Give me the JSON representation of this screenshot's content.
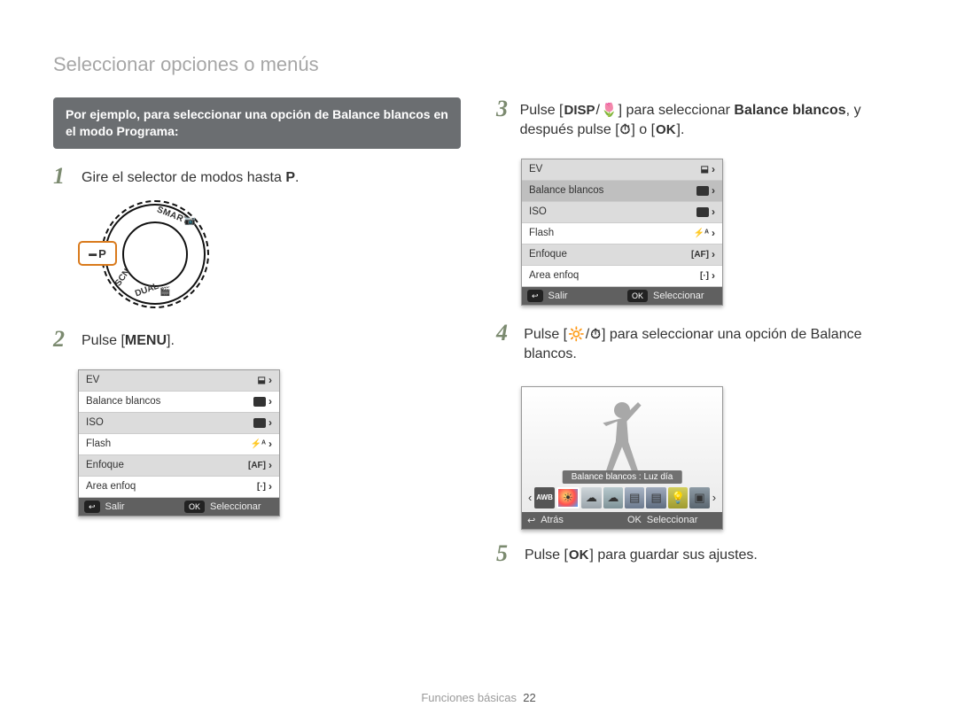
{
  "page_title": "Seleccionar opciones o menús",
  "example_box": "Por ejemplo, para seleccionar una opción de Balance blancos en el modo Programa:",
  "steps": {
    "s1": {
      "num": "1",
      "pre": "Gire el selector de modos hasta ",
      "mode": "P",
      "post": "."
    },
    "s2": {
      "num": "2",
      "pre": "Pulse [",
      "key": "MENU",
      "post": "]."
    },
    "s3": {
      "num": "3",
      "pre": "Pulse [",
      "key1": "DISP",
      "sep": "/",
      "key2": "🌷",
      "mid": "] para seleccionar ",
      "target": "Balance blancos",
      "post1": ", y después pulse [",
      "key3": "⏱",
      "post2": "] o [",
      "key4": "OK",
      "post3": "]."
    },
    "s4": {
      "num": "4",
      "pre": "Pulse [",
      "key1": "🔆",
      "sep": "/",
      "key2": "⏱",
      "post": "] para seleccionar una opción de Balance blancos."
    },
    "s5": {
      "num": "5",
      "pre": "Pulse [",
      "key": "OK",
      "post": "] para guardar sus ajustes."
    }
  },
  "dial": {
    "selected": "P",
    "labels": {
      "smart": "SMART",
      "scn": "SCN",
      "dual": "DUAL"
    }
  },
  "lcd_menu": {
    "rows": [
      {
        "label": "EV",
        "value": "⬓"
      },
      {
        "label": "Balance blancos",
        "value": "AWB"
      },
      {
        "label": "ISO",
        "value": "ISO"
      },
      {
        "label": "Flash",
        "value": "⚡ᴬ"
      },
      {
        "label": "Enfoque",
        "value": "[AF]"
      },
      {
        "label": "Area enfoq",
        "value": "[·]"
      }
    ],
    "foot_left_icon": "↩",
    "foot_left": "Salir",
    "foot_right_icon": "OK",
    "foot_right": "Seleccionar"
  },
  "lcd_menu_b": {
    "selected_index": 1
  },
  "wb_screen": {
    "label": "Balance blancos : Luz día",
    "foot_left_icon": "↩",
    "foot_left": "Atrás",
    "foot_right_icon": "OK",
    "foot_right": "Seleccionar"
  },
  "footer": {
    "section": "Funciones básicas",
    "page": "22"
  }
}
